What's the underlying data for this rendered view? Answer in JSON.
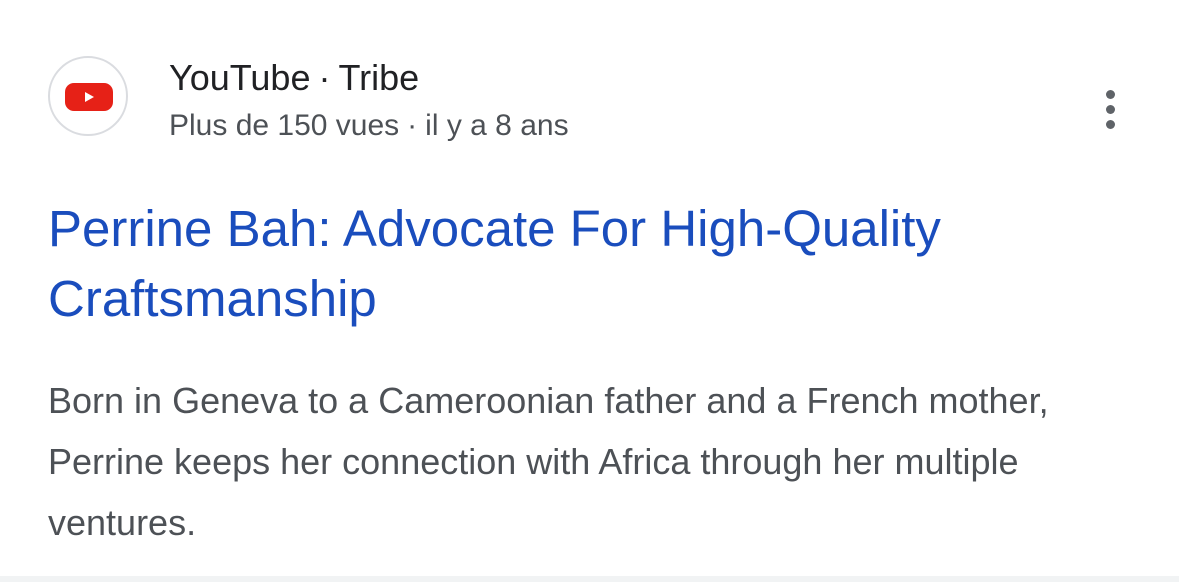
{
  "source": {
    "site_name": "YouTube",
    "channel": "Tribe",
    "separator": "·",
    "views": "Plus de 150 vues",
    "age": "il y a 8 ans",
    "favicon_icon": "youtube-logo-icon",
    "favicon_color": "#e62117"
  },
  "result": {
    "title": "Perrine Bah: Advocate For High-Quality Craftsmanship",
    "snippet": "Born in Geneva to a Cameroonian father and a French mother, Perrine keeps her connection with Africa through her multiple ventures.",
    "title_color": "#1a4dbd"
  },
  "menu": {
    "icon": "more-vert-icon"
  }
}
